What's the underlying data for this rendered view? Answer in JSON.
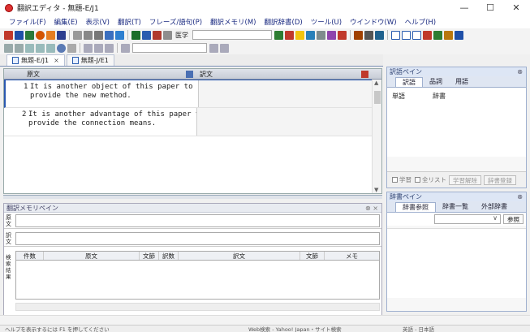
{
  "window": {
    "title": "翻訳エディタ - 無題-E/J1",
    "minimize": "—",
    "maximize": "☐",
    "close": "✕"
  },
  "menu": [
    "ファイル(F)",
    "編集(E)",
    "表示(V)",
    "翻訳(T)",
    "フレーズ/語句(P)",
    "翻訳メモリ(M)",
    "翻訳辞書(D)",
    "ツール(U)",
    "ウインドウ(W)",
    "ヘルプ(H)"
  ],
  "toolbar": {
    "field_label": "医学"
  },
  "tabs": [
    {
      "label": "無題-E/J1",
      "close": "×"
    },
    {
      "label": "無題-J/E1"
    }
  ],
  "grid": {
    "source_header": "原文",
    "target_header": "訳文",
    "rows": [
      {
        "num": "1",
        "source": "It is another object of this paper to provide the new method.",
        "target": ""
      },
      {
        "num": "2",
        "source": "It is another advantage of this paper to provide the connection means.",
        "target": ""
      }
    ]
  },
  "tm_pane": {
    "title": "翻訳メモリペイン",
    "close": "⊗ ×",
    "source_label": "原文",
    "target_label": "訳文",
    "side_label": "検索結果",
    "columns": [
      "件数",
      "原文",
      "文節",
      "訳数",
      "訳文",
      "文節",
      "メモ"
    ]
  },
  "term_pane": {
    "title": "訳語ペイン",
    "pin": "⊗",
    "tabs": [
      "訳語",
      "品詞",
      "用語"
    ],
    "columns": [
      "単語",
      "辞書"
    ],
    "footer": {
      "learn": "学習",
      "all_list": "全リスト",
      "btn_learn_reg": "学習解除",
      "btn_dict_reg": "辞書登録"
    }
  },
  "dict_pane": {
    "title": "辞書ペイン",
    "pin": "⊗",
    "tabs": [
      "辞書参照",
      "辞書一覧",
      "外部辞書"
    ],
    "ref_button": "参照"
  },
  "statusbar": [
    "ヘルプを表示するには F1 を押してください",
    "Web検索 - Yahoo! Japan・サイト検索",
    "",
    "英語 - 日本語"
  ]
}
